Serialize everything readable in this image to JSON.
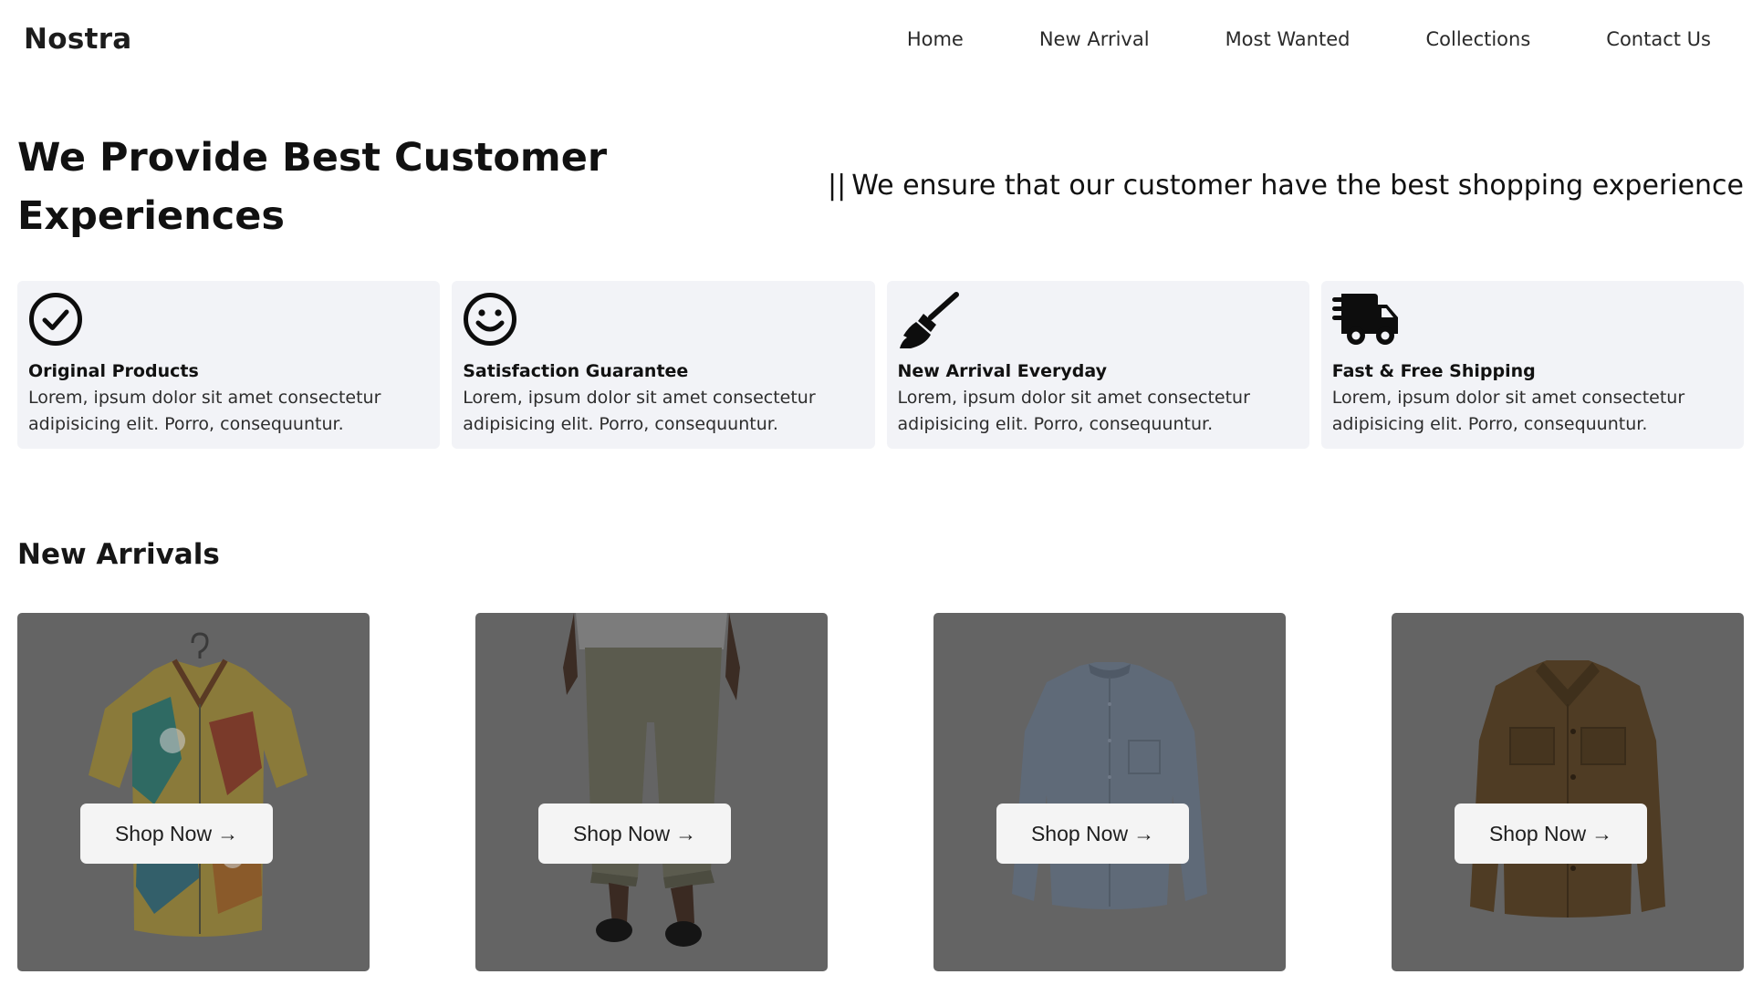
{
  "header": {
    "logo": "Nostra",
    "nav": [
      "Home",
      "New Arrival",
      "Most Wanted",
      "Collections",
      "Contact Us"
    ]
  },
  "hero": {
    "title": "We Provide Best Customer Experiences",
    "tagline_bars": "||",
    "tagline": "We ensure that our customer have the best shopping experience"
  },
  "features": [
    {
      "icon": "check-circle-icon",
      "title": "Original Products",
      "desc": "Lorem, ipsum dolor sit amet consectetur adipisicing elit. Porro, consequuntur."
    },
    {
      "icon": "smile-icon",
      "title": "Satisfaction Guarantee",
      "desc": "Lorem, ipsum dolor sit amet consectetur adipisicing elit. Porro, consequuntur."
    },
    {
      "icon": "broom-icon",
      "title": "New Arrival Everyday",
      "desc": "Lorem, ipsum dolor sit amet consectetur adipisicing elit. Porro, consequuntur."
    },
    {
      "icon": "truck-fast-icon",
      "title": "Fast & Free Shipping",
      "desc": "Lorem, ipsum dolor sit amet consectetur adipisicing elit. Porro, consequuntur."
    }
  ],
  "new_arrivals": {
    "title": "New Arrivals",
    "products": [
      {
        "image": "floral-shirt",
        "button": "Shop Now",
        "arrow": "→"
      },
      {
        "image": "linen-trousers",
        "button": "Shop Now",
        "arrow": "→"
      },
      {
        "image": "blue-shirt",
        "button": "Shop Now",
        "arrow": "→"
      },
      {
        "image": "brown-jacket",
        "button": "Shop Now",
        "arrow": "→"
      }
    ]
  },
  "colors": {
    "card_background": "#f2f3f7",
    "product_overlay": "#646464",
    "button_background": "#f4f4f4"
  }
}
